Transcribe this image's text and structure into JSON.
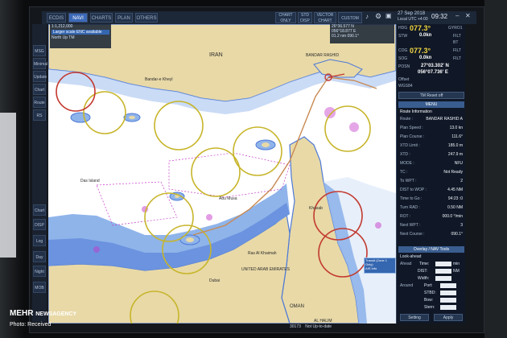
{
  "top_tabs": [
    "ECDIS",
    "NAVI",
    "CHARTS",
    "PLAN",
    "OTHERS"
  ],
  "active_tab": "NAVI",
  "top_buttons": [
    {
      "line1": "CHART",
      "line2": "ONLY"
    },
    {
      "line1": "STD",
      "line2": "DISP"
    },
    {
      "line1": "VECTOR",
      "line2": "CHART"
    },
    {
      "line1": "CUSTOM",
      "line2": ""
    }
  ],
  "date": "27 Sep 2018",
  "local_time_label": "Local UTC +4:00",
  "clock": "09:32",
  "top_left_lines": [
    "1:1,212,000",
    "Larger scale ENC available",
    "North Up TM"
  ],
  "ownship_readout": [
    "26°36.577 N",
    "056°18.877 E",
    "01.2 nm 090.1°"
  ],
  "left_buttons": [
    "MSG",
    "Minimal",
    "Update",
    "Chart",
    "Route",
    "RS",
    "Chart",
    "DISP",
    "Log",
    "Day",
    "Night",
    "MOB"
  ],
  "chart_scale_note": "1:1,212,000",
  "place_labels": [
    "BANDAR RASHID",
    "Bandar-e Kheyl",
    "IRAN",
    "Khasab",
    "UNITED ARAB EMIRATES",
    "Ras Al Khaimah",
    "OMAN",
    "AL HALIM",
    "Das Island",
    "Abu Musa",
    "Dubai"
  ],
  "right_panel": {
    "hdg_label": "HDG",
    "hdg": "077.3°",
    "hdg_source": "GYRO1",
    "stw_label": "STW",
    "stw": "0.0kn",
    "stw_filt": "FILT",
    "bt_label": "BT",
    "cog_label": "COG",
    "cog": "077.3°",
    "cog_filt": "FILT",
    "sog_label": "SOG",
    "sog": "0.0kn",
    "sog_filt": "FILT",
    "posn_label": "POSN",
    "lat": "27°03.302' N",
    "lon": "056°07.736' E",
    "offset_label": "Offset",
    "datum": "WGS84",
    "tm_reset": "TM Reset off",
    "menu_label": "MENU",
    "route_info_title": "Route Information",
    "route_rows": [
      {
        "k": "Route :",
        "v": "BANDAR RASHID A"
      },
      {
        "k": "Plan Speed :",
        "v": "13.0 kn"
      },
      {
        "k": "Plan Course :",
        "v": "111.6°"
      },
      {
        "k": "XTD Limit :",
        "v": "185.0 m"
      },
      {
        "k": "XTD :",
        "v": "247.9 m"
      },
      {
        "k": "MODE :",
        "v": "NFU"
      },
      {
        "k": "TC :",
        "v": "Not Ready"
      },
      {
        "k": "To WPT :",
        "v": "2"
      },
      {
        "k": "DIST to WOP :",
        "v": "4.45 NM"
      },
      {
        "k": "Time to Go :",
        "v": "94:23 :0"
      },
      {
        "k": "Turn RAD :",
        "v": "0.50 NM"
      },
      {
        "k": "ROT :",
        "v": "000.0 °/min"
      },
      {
        "k": "Next WPT :",
        "v": "3"
      },
      {
        "k": "Next Course :",
        "v": "090.1°"
      }
    ],
    "overlay_tools": "Overlay / NAV Tools",
    "lookahead_title": "Look-ahead",
    "ahead_label": "Ahead",
    "time_label": "Time:",
    "time_unit": "min",
    "dist_label": "DIST:",
    "dist_unit": "NM",
    "width_label": "Width:",
    "around_label": "Around",
    "port_label": "Port:",
    "stbd_label": "STBD:",
    "bow_label": "Bow:",
    "stern_label": "Stern:",
    "setting_label": "Setting",
    "apply_label": "Apply",
    "bottom_note_num": "30173",
    "bottom_note": "Not Up-to-date"
  },
  "chart_popup": [
    "Transit (Zone 1 Only)",
    "AIS Info"
  ],
  "watermark_brand": "MEHR",
  "watermark_agency": "NEWSAGENCY",
  "watermark_credit": "Photo: Received",
  "colors": {
    "land": "#e8d9a7",
    "shallow": "#8fb4ea",
    "deep_sea": "#ffffff",
    "coast_blue": "#4e79d6",
    "route": "#c88a52",
    "ring_yellow": "#c7b52a",
    "ring_red": "#c3392f",
    "magenta": "#c53ac9"
  }
}
